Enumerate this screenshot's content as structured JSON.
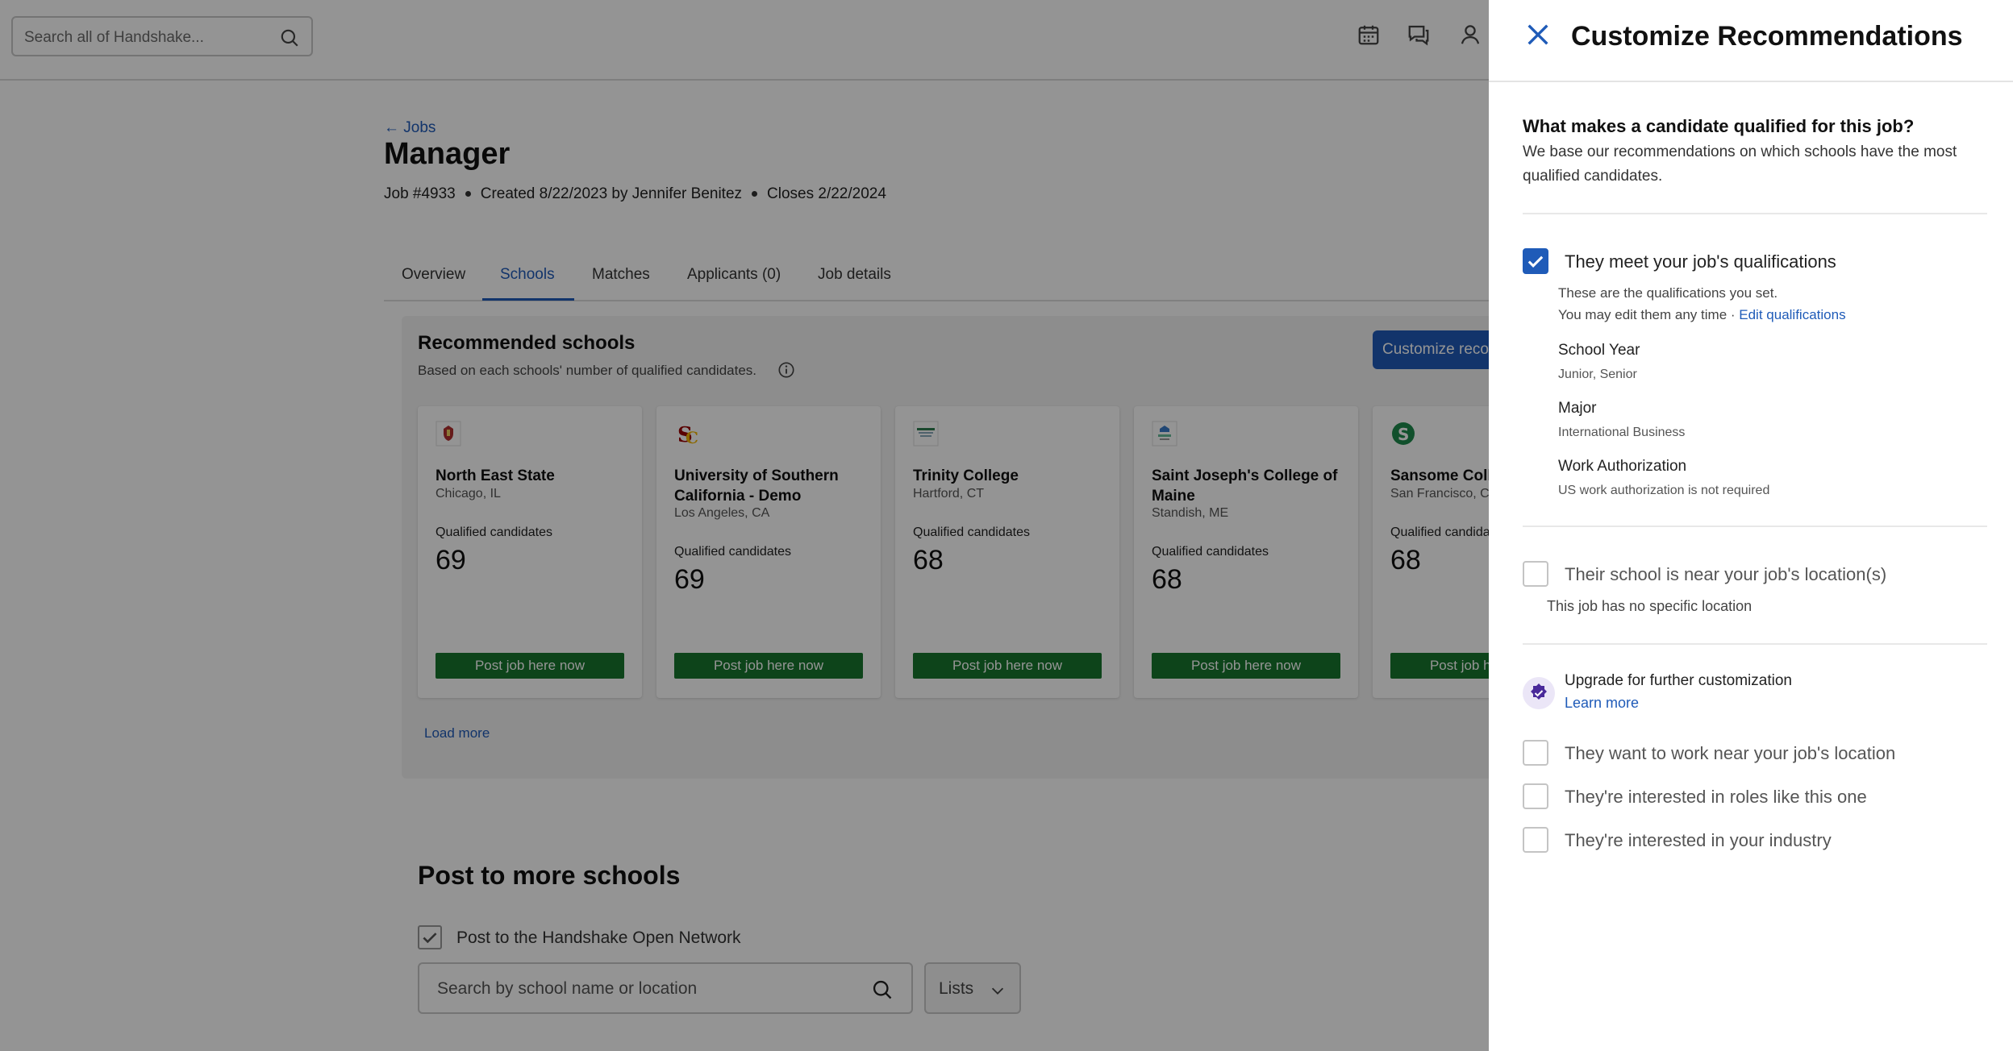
{
  "topbar": {
    "search_placeholder": "Search all of Handshake...",
    "icons": [
      "calendar-icon",
      "messages-icon",
      "user-icon"
    ]
  },
  "job": {
    "back_label": "← Jobs",
    "title": "Manager",
    "number": "Job #4933",
    "created": "Created 8/22/2023 by Jennifer Benitez",
    "closes": "Closes 2/22/2024"
  },
  "tabs": [
    {
      "label": "Overview",
      "active": false
    },
    {
      "label": "Schools",
      "active": true
    },
    {
      "label": "Matches",
      "active": false
    },
    {
      "label": "Applicants (0)",
      "active": false
    },
    {
      "label": "Job details",
      "active": false
    }
  ],
  "recommended": {
    "title": "Recommended schools",
    "subtitle": "Based on each schools' number of qualified candidates.",
    "customize_button": "Customize recommendations",
    "qualified_label": "Qualified candidates",
    "post_button": "Post job here now",
    "load_more": "Load more",
    "schools": [
      {
        "name": "North East State",
        "location": "Chicago, IL",
        "qualified": "69",
        "logo_color": "#b03030"
      },
      {
        "name": "University of Southern California - Demo",
        "location": "Los Angeles, CA",
        "qualified": "69",
        "logo_color": "#990000"
      },
      {
        "name": "Trinity College",
        "location": "Hartford, CT",
        "qualified": "68",
        "logo_color": "#2e7d4f"
      },
      {
        "name": "Saint Joseph's College of Maine",
        "location": "Standish, ME",
        "qualified": "68",
        "logo_color": "#3a7bc8"
      },
      {
        "name": "Sansome College",
        "location": "San Francisco, CA",
        "qualified": "68",
        "logo_color": "#1e8a4c"
      }
    ]
  },
  "post_more": {
    "title": "Post to more schools",
    "open_network_label": "Post to the Handshake Open Network",
    "open_network_checked": true,
    "search_placeholder": "Search by school name or location",
    "lists_label": "Lists"
  },
  "drawer": {
    "title": "Customize Recommendations",
    "question": "What makes a candidate qualified for this job?",
    "description": "We base our recommendations on which schools have the most qualified candidates.",
    "option_qualifications": {
      "label": "They meet your job's qualifications",
      "checked": true,
      "note1": "These are the qualifications you set.",
      "note2": "You may edit them any time · ",
      "edit_link": "Edit qualifications",
      "fields": [
        {
          "label": "School Year",
          "value": "Junior, Senior"
        },
        {
          "label": "Major",
          "value": "International Business"
        },
        {
          "label": "Work Authorization",
          "value": "US work authorization is not required"
        }
      ]
    },
    "option_location": {
      "label": "Their school is near your job's location(s)",
      "checked": false,
      "note": "This job has no specific location"
    },
    "upgrade": {
      "text": "Upgrade for further customization",
      "link": "Learn more"
    },
    "premium_options": [
      {
        "label": "They want to work near your job's location",
        "checked": false
      },
      {
        "label": "They're interested in roles like this one",
        "checked": false
      },
      {
        "label": "They're interested in your industry",
        "checked": false
      }
    ]
  },
  "colors": {
    "accent": "#1f5bb8",
    "post_button": "#17762e",
    "overlay": "rgba(0,0,0,0.42)"
  }
}
